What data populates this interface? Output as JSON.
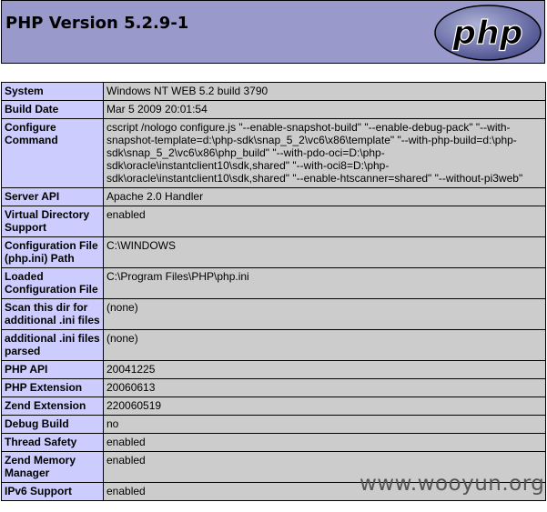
{
  "header": {
    "title": "PHP Version 5.2.9-1",
    "logo_text": "php",
    "logo_icon": "php-logo-icon"
  },
  "info_rows": [
    {
      "key": "System",
      "value": "Windows NT WEB 5.2 build 3790"
    },
    {
      "key": "Build Date",
      "value": "Mar 5 2009 20:01:54"
    },
    {
      "key": "Configure Command",
      "value": "cscript /nologo configure.js \"--enable-snapshot-build\" \"--enable-debug-pack\" \"--with-snapshot-template=d:\\php-sdk\\snap_5_2\\vc6\\x86\\template\" \"--with-php-build=d:\\php-sdk\\snap_5_2\\vc6\\x86\\php_build\" \"--with-pdo-oci=D:\\php-sdk\\oracle\\instantclient10\\sdk,shared\" \"--with-oci8=D:\\php-sdk\\oracle\\instantclient10\\sdk,shared\" \"--enable-htscanner=shared\" \"--without-pi3web\""
    },
    {
      "key": "Server API",
      "value": "Apache 2.0 Handler"
    },
    {
      "key": "Virtual Directory Support",
      "value": "enabled"
    },
    {
      "key": "Configuration File (php.ini) Path",
      "value": "C:\\WINDOWS"
    },
    {
      "key": "Loaded Configuration File",
      "value": "C:\\Program Files\\PHP\\php.ini"
    },
    {
      "key": "Scan this dir for additional .ini files",
      "value": "(none)"
    },
    {
      "key": "additional .ini files parsed",
      "value": "(none)"
    },
    {
      "key": "PHP API",
      "value": "20041225"
    },
    {
      "key": "PHP Extension",
      "value": "20060613"
    },
    {
      "key": "Zend Extension",
      "value": "220060519"
    },
    {
      "key": "Debug Build",
      "value": "no"
    },
    {
      "key": "Thread Safety",
      "value": "enabled"
    },
    {
      "key": "Zend Memory Manager",
      "value": "enabled"
    },
    {
      "key": "IPv6 Support",
      "value": "enabled"
    }
  ],
  "watermark": "www.wooyun.org",
  "colors": {
    "header_bg": "#9999cc",
    "key_bg": "#ccccff",
    "value_bg": "#cccccc"
  }
}
